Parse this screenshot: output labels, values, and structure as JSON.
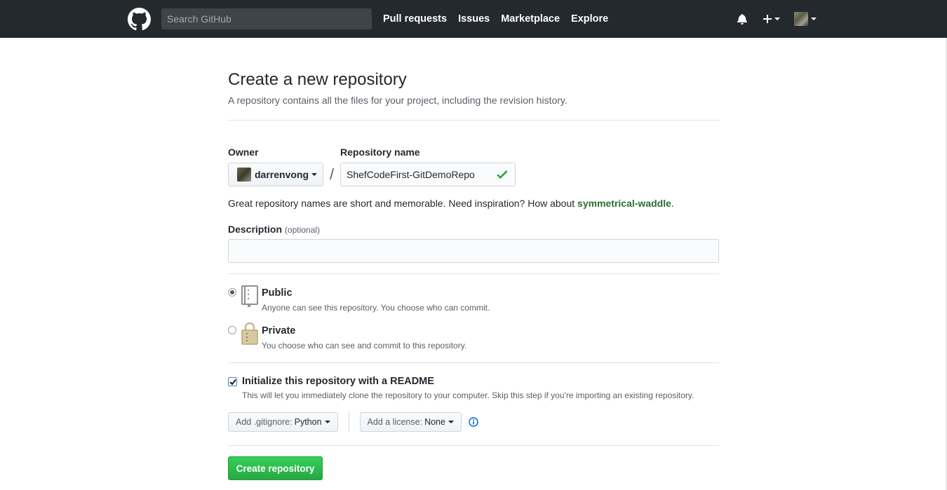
{
  "header": {
    "search_placeholder": "Search GitHub",
    "nav": [
      "Pull requests",
      "Issues",
      "Marketplace",
      "Explore"
    ],
    "plus_label": "+"
  },
  "page": {
    "title": "Create a new repository",
    "subtitle": "A repository contains all the files for your project, including the revision history."
  },
  "form": {
    "owner_label": "Owner",
    "repo_label": "Repository name",
    "owner_value": "darrenvong",
    "slash": "/",
    "repo_value": "ShefCodeFirst-GitDemoRepo",
    "hint_prefix": "Great repository names are short and memorable. Need inspiration? How about ",
    "hint_suggestion": "symmetrical-waddle",
    "hint_suffix": ".",
    "description_label": "Description",
    "description_optional": "(optional)",
    "description_value": ""
  },
  "visibility": {
    "public_title": "Public",
    "public_sub": "Anyone can see this repository. You choose who can commit.",
    "private_title": "Private",
    "private_sub": "You choose who can see and commit to this repository.",
    "selected": "public"
  },
  "readme": {
    "title": "Initialize this repository with a README",
    "sub": "This will let you immediately clone the repository to your computer. Skip this step if you're importing an existing repository.",
    "checked": true
  },
  "options": {
    "gitignore_label": "Add .gitignore:",
    "gitignore_value": "Python",
    "license_label": "Add a license:",
    "license_value": "None"
  },
  "submit_label": "Create repository",
  "colors": {
    "header_bg": "#24292e",
    "primary_green": "#28a745",
    "suggestion_green": "#2c6e2f"
  }
}
